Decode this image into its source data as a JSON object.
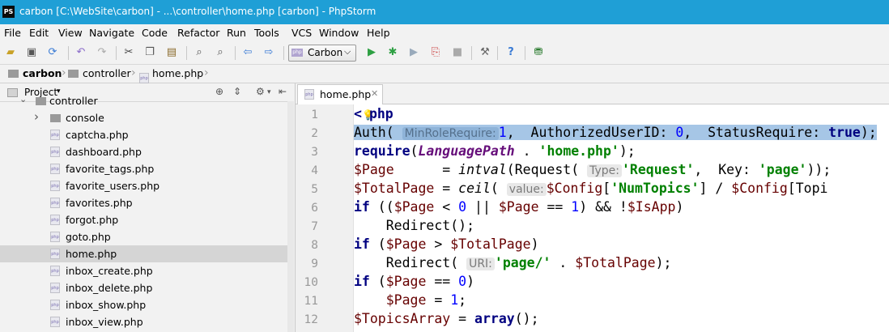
{
  "window": {
    "app_icon": "PS",
    "title": "carbon [C:\\WebSite\\carbon] - ...\\controller\\home.php [carbon] - PhpStorm"
  },
  "menu": [
    "File",
    "Edit",
    "View",
    "Navigate",
    "Code",
    "Refactor",
    "Run",
    "Tools",
    "VCS",
    "Window",
    "Help"
  ],
  "toolbar": {
    "icons": [
      "open-folder-icon",
      "save-icon",
      "sync-icon",
      "undo-icon",
      "redo-icon",
      "cut-icon",
      "copy-icon",
      "paste-icon",
      "find-icon",
      "replace-icon",
      "back-icon",
      "forward-icon",
      "run-icon",
      "debug-icon",
      "coverage-icon",
      "attach-icon",
      "stop-icon",
      "settings-icon",
      "help-icon",
      "vcs-update-icon"
    ],
    "run_config": "Carbon",
    "run_config_icon": "php"
  },
  "breadcrumb": [
    "carbon",
    "controller",
    "home.php"
  ],
  "project_panel": {
    "label": "Project",
    "tree": [
      {
        "label": "controller",
        "type": "folder",
        "expanded": true,
        "depth": 1
      },
      {
        "label": "console",
        "type": "folder",
        "expanded": false,
        "depth": 2
      },
      {
        "label": "captcha.php",
        "type": "php",
        "depth": 3
      },
      {
        "label": "dashboard.php",
        "type": "php",
        "depth": 3
      },
      {
        "label": "favorite_tags.php",
        "type": "php",
        "depth": 3
      },
      {
        "label": "favorite_users.php",
        "type": "php",
        "depth": 3
      },
      {
        "label": "favorites.php",
        "type": "php",
        "depth": 3
      },
      {
        "label": "forgot.php",
        "type": "php",
        "depth": 3
      },
      {
        "label": "goto.php",
        "type": "php",
        "depth": 3
      },
      {
        "label": "home.php",
        "type": "php",
        "depth": 3,
        "selected": true
      },
      {
        "label": "inbox_create.php",
        "type": "php",
        "depth": 3
      },
      {
        "label": "inbox_delete.php",
        "type": "php",
        "depth": 3
      },
      {
        "label": "inbox_show.php",
        "type": "php",
        "depth": 3
      },
      {
        "label": "inbox_view.php",
        "type": "php",
        "depth": 3
      }
    ]
  },
  "editor": {
    "tab": "home.php",
    "line_numbers": [
      "1",
      "2",
      "3",
      "4",
      "5",
      "6",
      "7",
      "8",
      "9",
      "10",
      "11",
      "12"
    ],
    "lines": [
      "<?php",
      "Auth( MinRoleRequire: 1,  AuthorizedUserID: 0,  StatusRequire: true);",
      "require(LanguagePath . 'home.php');",
      "$Page      = intval(Request( Type: 'Request',  Key: 'page'));",
      "$TotalPage = ceil( value: $Config['NumTopics'] / $Config['Topi",
      "if (($Page < 0 || $Page == 1) && !$IsApp)",
      "    Redirect();",
      "if ($Page > $TotalPage)",
      "    Redirect( URI: 'page/' . $TotalPage);",
      "if ($Page == 0)",
      "    $Page = 1;",
      "$TopicsArray = array();"
    ],
    "current_line": 2
  }
}
